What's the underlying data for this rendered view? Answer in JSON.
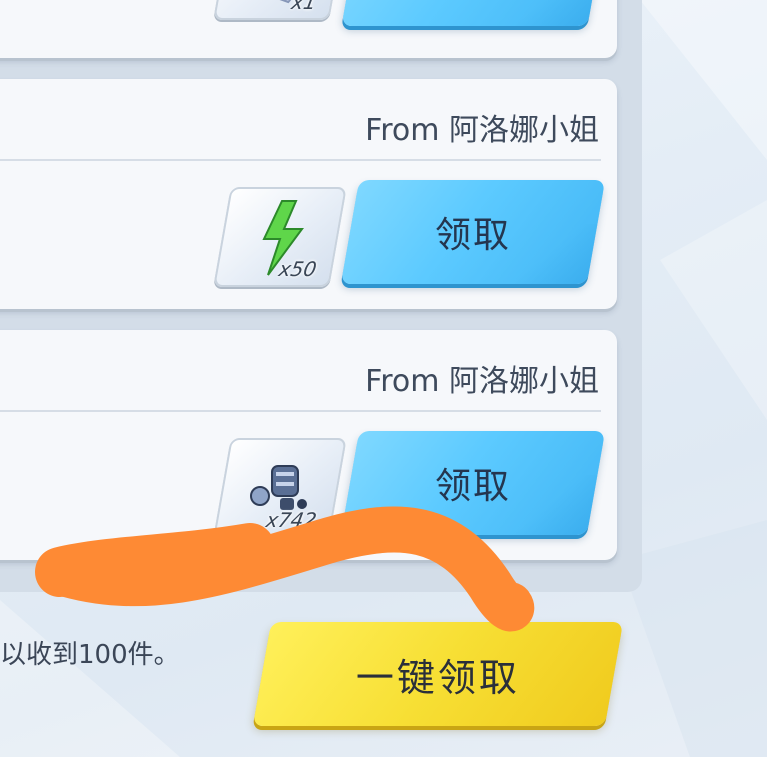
{
  "mail_list": {
    "items": [
      {
        "sender": "",
        "item": {
          "icon": "ticket-icon",
          "count": "x1"
        },
        "claim_label": ""
      },
      {
        "sender": "From 阿洛娜小姐",
        "item": {
          "icon": "lightning-bolt-icon",
          "count": "x50"
        },
        "claim_label": "领取"
      },
      {
        "sender": "From 阿洛娜小姐",
        "item": {
          "icon": "robot-parts-icon",
          "count": "x742"
        },
        "claim_label": "领取"
      }
    ]
  },
  "footer": {
    "note": "以收到100件。",
    "claim_all_label": "一键领取"
  },
  "colors": {
    "claim_button": "#5ccaff",
    "claim_all_button": "#f7df34",
    "annotation_stroke": "#fe8a34"
  }
}
